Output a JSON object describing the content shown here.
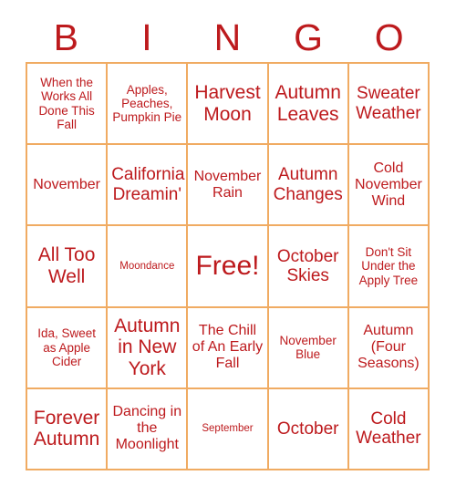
{
  "card": {
    "title_letters": [
      "B",
      "I",
      "N",
      "G",
      "O"
    ],
    "accent_color": "#bd1a1d",
    "border_color": "#f0ab62",
    "background_color": "#ffffff",
    "columns": 5,
    "rows": 5,
    "free_space_label": "Free!",
    "cells": [
      {
        "text": "When the Works All Done This Fall",
        "size": "size-sm",
        "free": false
      },
      {
        "text": "Apples, Peaches, Pumpkin Pie",
        "size": "size-sm",
        "free": false
      },
      {
        "text": "Harvest Moon",
        "size": "size-xl",
        "free": false
      },
      {
        "text": "Autumn Leaves",
        "size": "size-xl",
        "free": false
      },
      {
        "text": "Sweater Weather",
        "size": "size-lg",
        "free": false
      },
      {
        "text": "November",
        "size": "size-md",
        "free": false
      },
      {
        "text": "California Dreamin'",
        "size": "size-lg",
        "free": false
      },
      {
        "text": "November Rain",
        "size": "size-md",
        "free": false
      },
      {
        "text": "Autumn Changes",
        "size": "size-lg",
        "free": false
      },
      {
        "text": "Cold November Wind",
        "size": "size-md",
        "free": false
      },
      {
        "text": "All Too Well",
        "size": "size-xl",
        "free": false
      },
      {
        "text": "Moondance",
        "size": "size-xs",
        "free": false
      },
      {
        "text": "Free!",
        "size": "size-free",
        "free": true
      },
      {
        "text": "October Skies",
        "size": "size-lg",
        "free": false
      },
      {
        "text": "Don't Sit Under the Apply Tree",
        "size": "size-sm",
        "free": false
      },
      {
        "text": "Ida, Sweet as Apple Cider",
        "size": "size-sm",
        "free": false
      },
      {
        "text": "Autumn in New York",
        "size": "size-xl",
        "free": false
      },
      {
        "text": "The Chill of An Early Fall",
        "size": "size-md",
        "free": false
      },
      {
        "text": "November Blue",
        "size": "size-sm",
        "free": false
      },
      {
        "text": "Autumn (Four Seasons)",
        "size": "size-md",
        "free": false
      },
      {
        "text": "Forever Autumn",
        "size": "size-xl",
        "free": false
      },
      {
        "text": "Dancing in the Moonlight",
        "size": "size-md",
        "free": false
      },
      {
        "text": "September",
        "size": "size-xs",
        "free": false
      },
      {
        "text": "October",
        "size": "size-lg",
        "free": false
      },
      {
        "text": "Cold Weather",
        "size": "size-lg",
        "free": false
      }
    ]
  }
}
